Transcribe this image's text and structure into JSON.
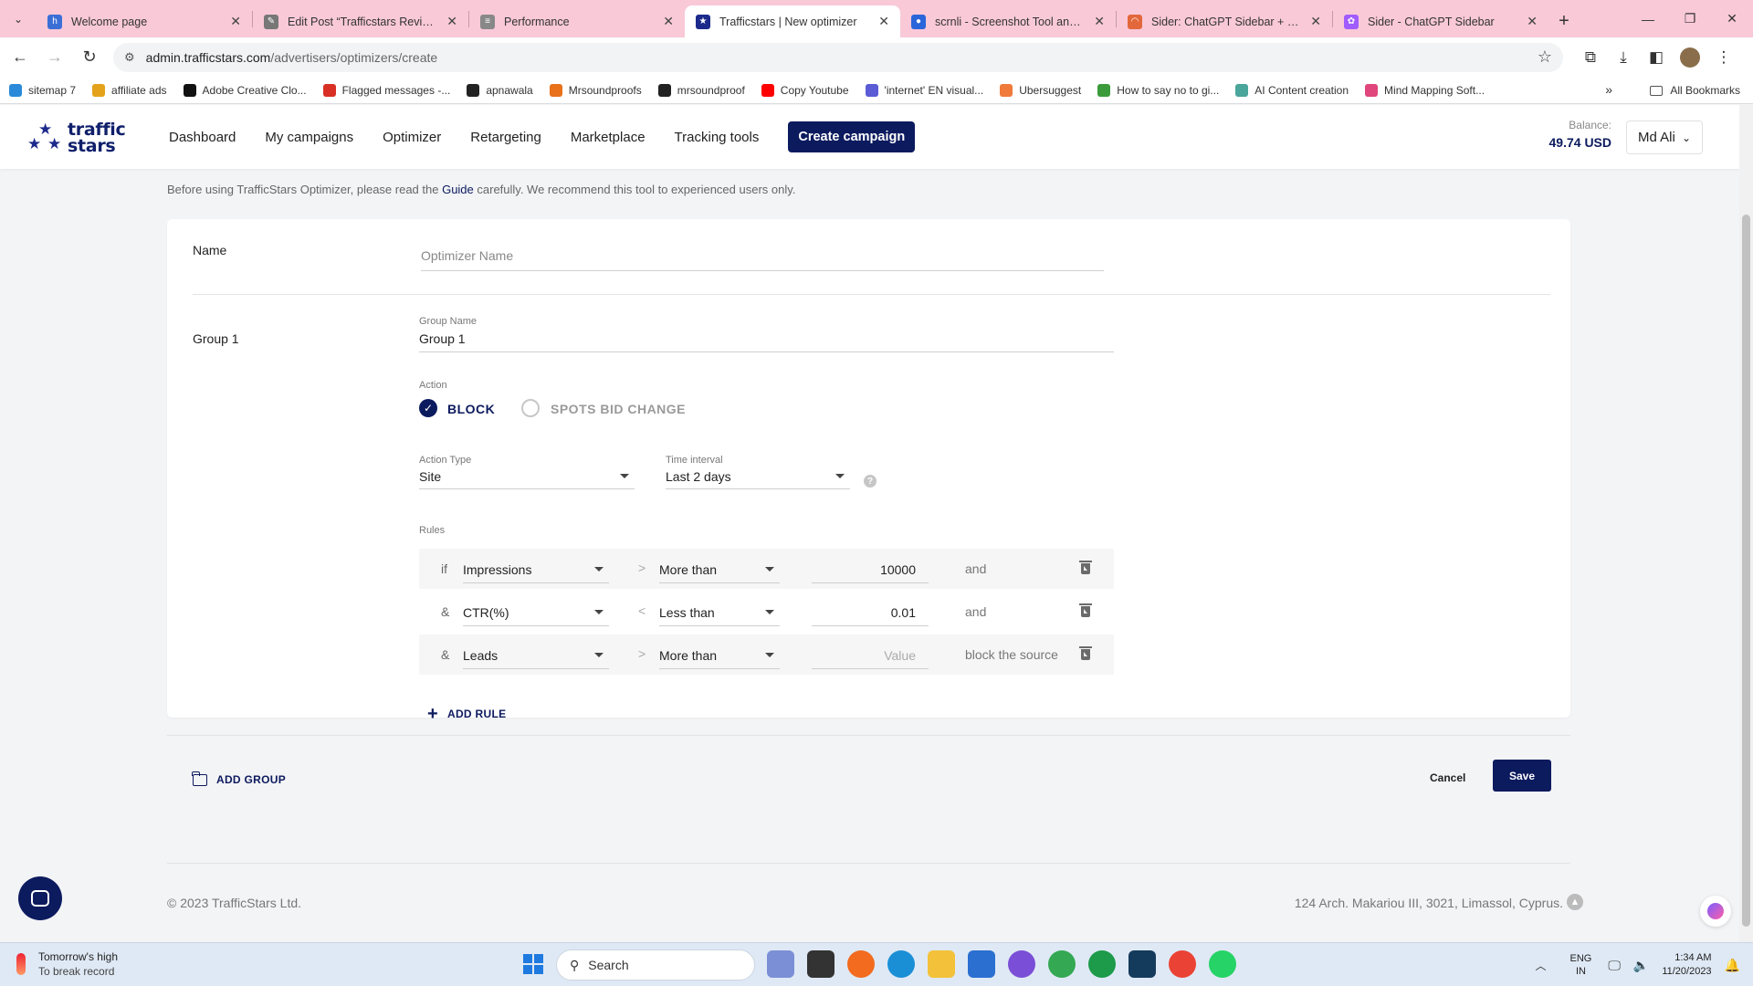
{
  "browser": {
    "tabs": [
      {
        "title": "Welcome page",
        "color": "#3b6fd6",
        "icon": "h"
      },
      {
        "title": "Edit Post “Trafficstars Review: M",
        "color": "#777777",
        "icon": "✎"
      },
      {
        "title": "Performance",
        "color": "#888888",
        "icon": "≡"
      },
      {
        "title": "Trafficstars | New optimizer",
        "color": "#1c2a8c",
        "icon": "★"
      },
      {
        "title": "scrnli - Screenshot Tool and Ed",
        "color": "#2a66d9",
        "icon": "●"
      },
      {
        "title": "Sider: ChatGPT Sidebar + Vision",
        "color": "#e2673a",
        "icon": "◠"
      },
      {
        "title": "Sider - ChatGPT Sidebar",
        "color": "#a05cff",
        "icon": "✿"
      }
    ],
    "url_host": "admin.trafficstars.com",
    "url_path": "/advertisers/optimizers/create",
    "bookmarks": [
      {
        "label": "sitemap 7",
        "color": "#2a8ad9"
      },
      {
        "label": "affiliate ads",
        "color": "#e3a21a"
      },
      {
        "label": "Adobe Creative Clo...",
        "color": "#111111"
      },
      {
        "label": "Flagged messages -...",
        "color": "#d93025"
      },
      {
        "label": "apnawala",
        "color": "#222222"
      },
      {
        "label": "Mrsoundproofs",
        "color": "#e8711a"
      },
      {
        "label": "mrsoundproof",
        "color": "#222222"
      },
      {
        "label": "Copy Youtube",
        "color": "#ff0000"
      },
      {
        "label": "'internet' EN visual...",
        "color": "#5b5bd6"
      },
      {
        "label": "Ubersuggest",
        "color": "#f07a3a"
      },
      {
        "label": "How to say no to gi...",
        "color": "#3b9b3b"
      },
      {
        "label": "AI Content creation",
        "color": "#4aa59b"
      },
      {
        "label": "Mind Mapping Soft...",
        "color": "#e0457b"
      }
    ],
    "all_bookmarks": "All Bookmarks"
  },
  "nav": {
    "logo_line1": "traffic",
    "logo_line2": "stars",
    "items": [
      "Dashboard",
      "My campaigns",
      "Optimizer",
      "Retargeting",
      "Marketplace",
      "Tracking tools"
    ],
    "create": "Create campaign",
    "balance_label": "Balance:",
    "balance_value": "49.74 USD",
    "user": "Md Ali"
  },
  "notice": {
    "before": "Before using TrafficStars Optimizer, please read the ",
    "link": "Guide",
    "after": " carefully. We recommend this tool to experienced users only."
  },
  "form": {
    "name_label": "Name",
    "name_placeholder": "Optimizer Name",
    "group_label": "Group 1",
    "group_name_label": "Group Name",
    "group_name_value": "Group 1",
    "action_label": "Action",
    "action_block": "BLOCK",
    "action_spots": "SPOTS BID CHANGE",
    "action_type_label": "Action Type",
    "action_type_value": "Site",
    "time_interval_label": "Time interval",
    "time_interval_value": "Last 2 days",
    "rules_label": "Rules",
    "rules": [
      {
        "prefix": "if",
        "metric": "Impressions",
        "op_icon": ">",
        "operator": "More than",
        "value": "10000",
        "suffix": "and"
      },
      {
        "prefix": "&",
        "metric": "CTR(%)",
        "op_icon": "<",
        "operator": "Less than",
        "value": "0.01",
        "suffix": "and"
      },
      {
        "prefix": "&",
        "metric": "Leads",
        "op_icon": ">",
        "operator": "More than",
        "value": "Value",
        "suffix": "block the source"
      }
    ],
    "add_rule": "ADD RULE",
    "add_group": "ADD GROUP",
    "cancel": "Cancel",
    "save": "Save"
  },
  "footer": {
    "copyright": "© 2023 TrafficStars Ltd.",
    "address": "124 Arch. Makariou III, 3021, Limassol, Cyprus."
  },
  "taskbar": {
    "weather_line1": "Tomorrow's high",
    "weather_line2": "To break record",
    "search": "Search",
    "lang1": "ENG",
    "lang2": "IN",
    "time": "1:34 AM",
    "date": "11/20/2023"
  },
  "colors": {
    "brand": "#0c1a5e",
    "tabbar": "#f9c9d8"
  }
}
